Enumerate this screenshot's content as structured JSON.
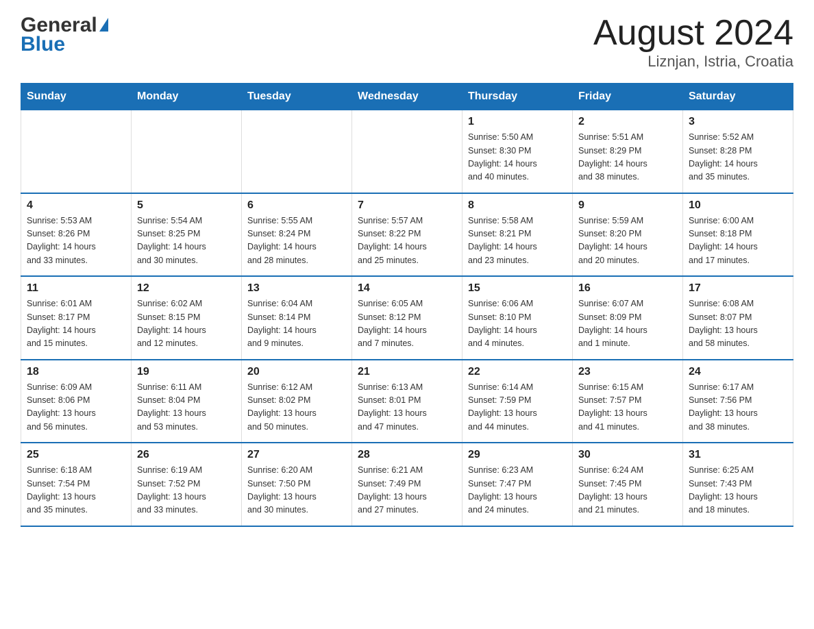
{
  "header": {
    "logo_general": "General",
    "logo_blue": "Blue",
    "month_title": "August 2024",
    "location": "Liznjan, Istria, Croatia"
  },
  "days_of_week": [
    "Sunday",
    "Monday",
    "Tuesday",
    "Wednesday",
    "Thursday",
    "Friday",
    "Saturday"
  ],
  "weeks": [
    [
      {
        "day": "",
        "info": ""
      },
      {
        "day": "",
        "info": ""
      },
      {
        "day": "",
        "info": ""
      },
      {
        "day": "",
        "info": ""
      },
      {
        "day": "1",
        "info": "Sunrise: 5:50 AM\nSunset: 8:30 PM\nDaylight: 14 hours\nand 40 minutes."
      },
      {
        "day": "2",
        "info": "Sunrise: 5:51 AM\nSunset: 8:29 PM\nDaylight: 14 hours\nand 38 minutes."
      },
      {
        "day": "3",
        "info": "Sunrise: 5:52 AM\nSunset: 8:28 PM\nDaylight: 14 hours\nand 35 minutes."
      }
    ],
    [
      {
        "day": "4",
        "info": "Sunrise: 5:53 AM\nSunset: 8:26 PM\nDaylight: 14 hours\nand 33 minutes."
      },
      {
        "day": "5",
        "info": "Sunrise: 5:54 AM\nSunset: 8:25 PM\nDaylight: 14 hours\nand 30 minutes."
      },
      {
        "day": "6",
        "info": "Sunrise: 5:55 AM\nSunset: 8:24 PM\nDaylight: 14 hours\nand 28 minutes."
      },
      {
        "day": "7",
        "info": "Sunrise: 5:57 AM\nSunset: 8:22 PM\nDaylight: 14 hours\nand 25 minutes."
      },
      {
        "day": "8",
        "info": "Sunrise: 5:58 AM\nSunset: 8:21 PM\nDaylight: 14 hours\nand 23 minutes."
      },
      {
        "day": "9",
        "info": "Sunrise: 5:59 AM\nSunset: 8:20 PM\nDaylight: 14 hours\nand 20 minutes."
      },
      {
        "day": "10",
        "info": "Sunrise: 6:00 AM\nSunset: 8:18 PM\nDaylight: 14 hours\nand 17 minutes."
      }
    ],
    [
      {
        "day": "11",
        "info": "Sunrise: 6:01 AM\nSunset: 8:17 PM\nDaylight: 14 hours\nand 15 minutes."
      },
      {
        "day": "12",
        "info": "Sunrise: 6:02 AM\nSunset: 8:15 PM\nDaylight: 14 hours\nand 12 minutes."
      },
      {
        "day": "13",
        "info": "Sunrise: 6:04 AM\nSunset: 8:14 PM\nDaylight: 14 hours\nand 9 minutes."
      },
      {
        "day": "14",
        "info": "Sunrise: 6:05 AM\nSunset: 8:12 PM\nDaylight: 14 hours\nand 7 minutes."
      },
      {
        "day": "15",
        "info": "Sunrise: 6:06 AM\nSunset: 8:10 PM\nDaylight: 14 hours\nand 4 minutes."
      },
      {
        "day": "16",
        "info": "Sunrise: 6:07 AM\nSunset: 8:09 PM\nDaylight: 14 hours\nand 1 minute."
      },
      {
        "day": "17",
        "info": "Sunrise: 6:08 AM\nSunset: 8:07 PM\nDaylight: 13 hours\nand 58 minutes."
      }
    ],
    [
      {
        "day": "18",
        "info": "Sunrise: 6:09 AM\nSunset: 8:06 PM\nDaylight: 13 hours\nand 56 minutes."
      },
      {
        "day": "19",
        "info": "Sunrise: 6:11 AM\nSunset: 8:04 PM\nDaylight: 13 hours\nand 53 minutes."
      },
      {
        "day": "20",
        "info": "Sunrise: 6:12 AM\nSunset: 8:02 PM\nDaylight: 13 hours\nand 50 minutes."
      },
      {
        "day": "21",
        "info": "Sunrise: 6:13 AM\nSunset: 8:01 PM\nDaylight: 13 hours\nand 47 minutes."
      },
      {
        "day": "22",
        "info": "Sunrise: 6:14 AM\nSunset: 7:59 PM\nDaylight: 13 hours\nand 44 minutes."
      },
      {
        "day": "23",
        "info": "Sunrise: 6:15 AM\nSunset: 7:57 PM\nDaylight: 13 hours\nand 41 minutes."
      },
      {
        "day": "24",
        "info": "Sunrise: 6:17 AM\nSunset: 7:56 PM\nDaylight: 13 hours\nand 38 minutes."
      }
    ],
    [
      {
        "day": "25",
        "info": "Sunrise: 6:18 AM\nSunset: 7:54 PM\nDaylight: 13 hours\nand 35 minutes."
      },
      {
        "day": "26",
        "info": "Sunrise: 6:19 AM\nSunset: 7:52 PM\nDaylight: 13 hours\nand 33 minutes."
      },
      {
        "day": "27",
        "info": "Sunrise: 6:20 AM\nSunset: 7:50 PM\nDaylight: 13 hours\nand 30 minutes."
      },
      {
        "day": "28",
        "info": "Sunrise: 6:21 AM\nSunset: 7:49 PM\nDaylight: 13 hours\nand 27 minutes."
      },
      {
        "day": "29",
        "info": "Sunrise: 6:23 AM\nSunset: 7:47 PM\nDaylight: 13 hours\nand 24 minutes."
      },
      {
        "day": "30",
        "info": "Sunrise: 6:24 AM\nSunset: 7:45 PM\nDaylight: 13 hours\nand 21 minutes."
      },
      {
        "day": "31",
        "info": "Sunrise: 6:25 AM\nSunset: 7:43 PM\nDaylight: 13 hours\nand 18 minutes."
      }
    ]
  ]
}
